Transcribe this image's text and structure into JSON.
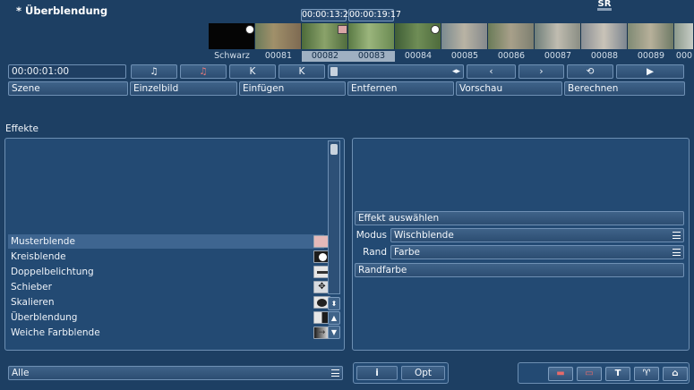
{
  "header": {
    "title": "* Überblendung",
    "badge": "SR"
  },
  "timecodes": {
    "in": "00:00:13:23",
    "out": "00:00:19:17"
  },
  "timeline": {
    "labels": [
      "Schwarz",
      "00081",
      "00082",
      "00083",
      "00084",
      "00085",
      "00086",
      "00087",
      "00088",
      "00089",
      "000"
    ]
  },
  "controls": {
    "time_field": "00:00:01:00",
    "buttons": [
      "Szene",
      "Einzelbild",
      "Einfügen",
      "Entfernen",
      "Vorschau",
      "Berechnen"
    ]
  },
  "effects": {
    "heading": "Effekte",
    "items": [
      {
        "label": "Musterblende",
        "icon": "pattern-wipe-icon"
      },
      {
        "label": "Kreisblende",
        "icon": "circle-wipe-icon"
      },
      {
        "label": "Doppelbelichtung",
        "icon": "double-exposure-icon"
      },
      {
        "label": "Schieber",
        "icon": "slide-icon"
      },
      {
        "label": "Skalieren",
        "icon": "scale-icon"
      },
      {
        "label": "Überblendung",
        "icon": "crossfade-icon"
      },
      {
        "label": "Weiche Farbblende",
        "icon": "soft-color-fade-icon"
      }
    ],
    "selected": "Musterblende",
    "filter": "Alle"
  },
  "settings": {
    "select_effect": "Effekt auswählen",
    "mode_label": "Modus",
    "mode_value": "Wischblende",
    "edge_label": "Rand",
    "edge_value": "Farbe",
    "edge_color": "Randfarbe"
  },
  "bottom": {
    "info": "i",
    "opt": "Opt"
  }
}
